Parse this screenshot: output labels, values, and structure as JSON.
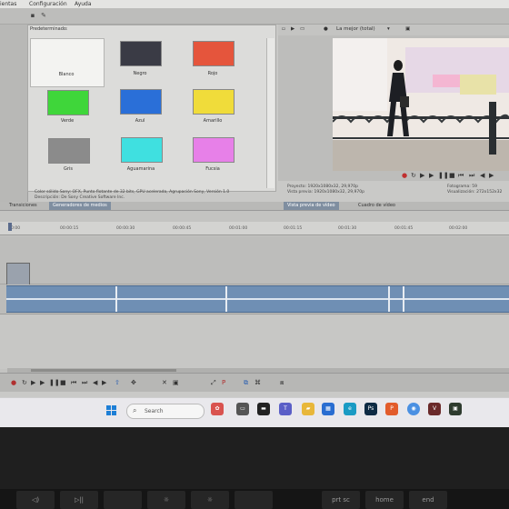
{
  "menu": {
    "items": [
      "ientas",
      "Configuración",
      "Ayuda"
    ]
  },
  "generator": {
    "header": "Predeterminado:",
    "swatches": [
      {
        "label": "Blanco",
        "color": "#f3f3f1"
      },
      {
        "label": "Negro",
        "color": "#3a3b45"
      },
      {
        "label": "Rojo",
        "color": "#e5553c"
      },
      {
        "label": "Verde",
        "color": "#3fd63a"
      },
      {
        "label": "Azul",
        "color": "#2a6fd8"
      },
      {
        "label": "Amarillo",
        "color": "#f0dc3a"
      },
      {
        "label": "Gris",
        "color": "#8b8b8b"
      },
      {
        "label": "Aguamarina",
        "color": "#3fe0e0"
      },
      {
        "label": "Fucsia",
        "color": "#e780e8"
      }
    ],
    "info_line1": "Color sólido Sony: OFX, Punto flotante de 32 bits, GPU acelerada, Agrupación Sony, Versión 1.0",
    "info_line2": "Descripción: De Sony Creative Software Inc."
  },
  "tabs": {
    "transitions": "Transiciones",
    "media_generators": "Generadores de medios",
    "video_preview": "Vista previa de vídeo",
    "trimmer": "Cuadro de vídeo"
  },
  "preview": {
    "quality": "La mejor (total)",
    "project_label": "Proyecto:",
    "project_value": "1920x1080x32, 29,970p",
    "preview_label": "Vista previa:",
    "preview_value": "1920x1080x32, 29,970p",
    "frame_label": "Fotograma:",
    "frame_value": "59",
    "display_label": "Visualización:",
    "display_value": "272x152x32"
  },
  "timeline": {
    "ticks": [
      "0:00",
      "00:00:15",
      "00:00:30",
      "00:00:45",
      "00:01:00",
      "00:01:15",
      "00:01:30",
      "00:01:45",
      "00:02:00"
    ]
  },
  "taskbar": {
    "search_placeholder": "Search"
  },
  "keyboard": {
    "keys": [
      "◁)",
      "▷||",
      "",
      "☼",
      "☼",
      "",
      "prt sc",
      "home",
      "end"
    ]
  },
  "colors": {
    "accent": "#7f8ea0",
    "waveform": "#6f8fb4",
    "windows_blue": "#1e7fd6"
  }
}
